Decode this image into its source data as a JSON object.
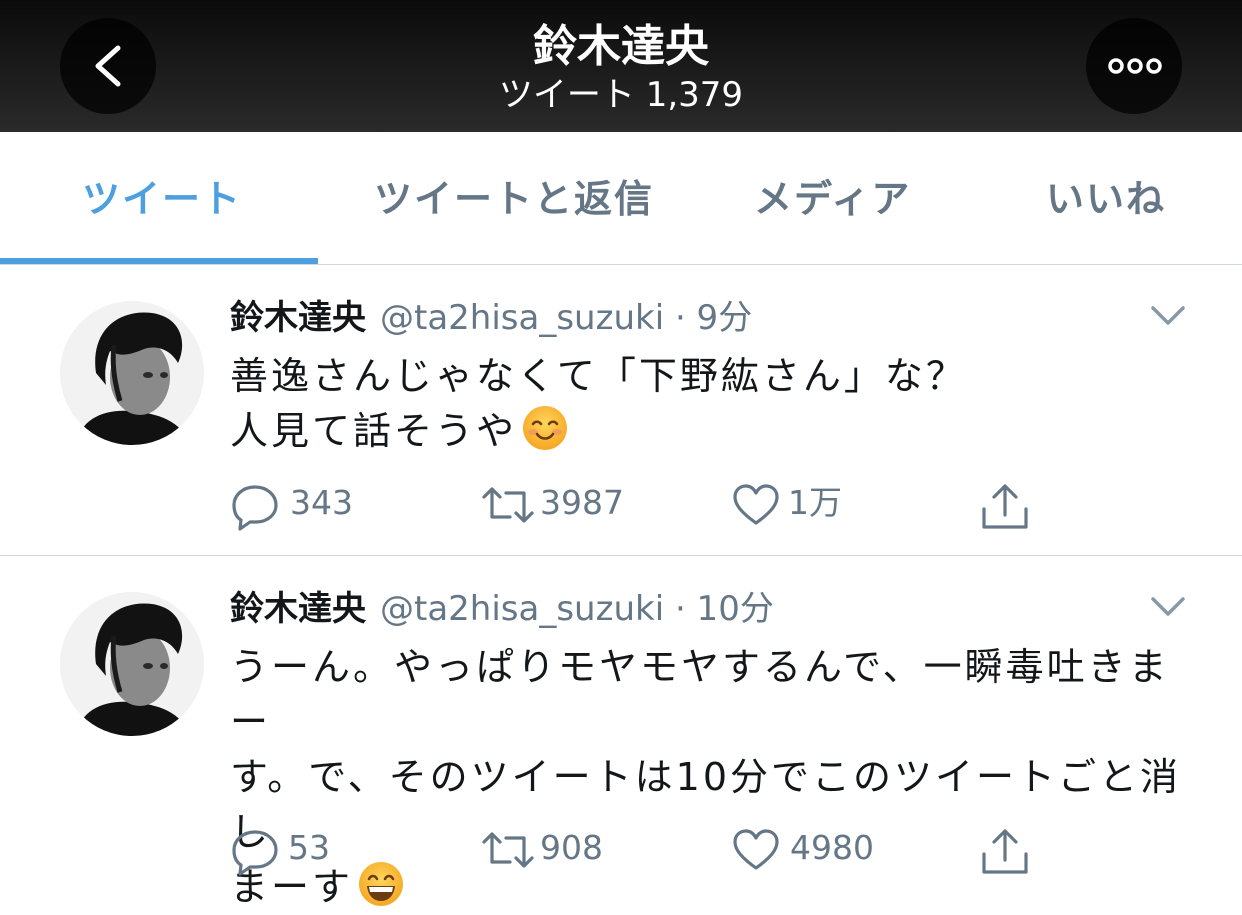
{
  "header": {
    "title": "鈴木達央",
    "subtitle": "ツイート 1,379"
  },
  "tabs": [
    {
      "label": "ツイート",
      "active": true
    },
    {
      "label": "ツイートと返信",
      "active": false
    },
    {
      "label": "メディア",
      "active": false
    },
    {
      "label": "いいね",
      "active": false
    }
  ],
  "colors": {
    "accent": "#4d9fe0",
    "muted": "#657786",
    "text": "#14171a",
    "divider": "#cfd6dc"
  },
  "tweets": [
    {
      "name": "鈴木達央",
      "meta": "@ta2hisa_suzuki · 9分",
      "lines": [
        "善逸さんじゃなくて「下野紘さん」な？",
        "人見て話そうや"
      ],
      "emoji": "smiling-face-icon",
      "replies": "343",
      "retweets": "3987",
      "likes": "1万"
    },
    {
      "name": "鈴木達央",
      "meta": "@ta2hisa_suzuki · 10分",
      "lines": [
        "うーん。やっぱりモヤモヤするんで、一瞬毒吐きまー",
        "す。で、そのツイートは10分でこのツイートごと消し",
        "まーす"
      ],
      "emoji": "grinning-face-icon",
      "replies": "53",
      "retweets": "908",
      "likes": "4980"
    }
  ]
}
